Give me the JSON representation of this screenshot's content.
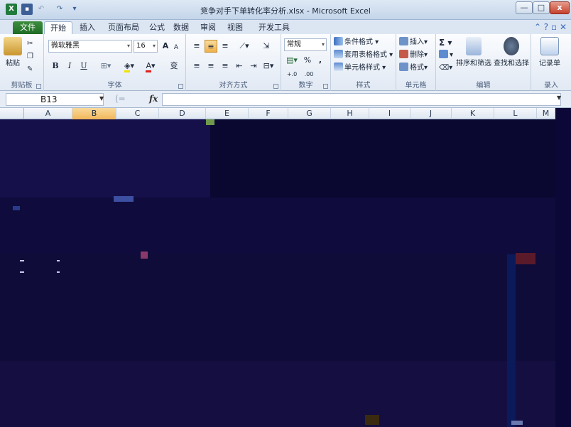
{
  "window": {
    "title": "竞争对手下单转化率分析.xlsx - Microsoft Excel",
    "app_icon_label": "X",
    "min_glyph": "—",
    "max_glyph": "□",
    "close_glyph": "x"
  },
  "tabs": [
    {
      "label": "文件"
    },
    {
      "label": "开始"
    },
    {
      "label": "插入"
    },
    {
      "label": "页面布局"
    },
    {
      "label": "公式"
    },
    {
      "label": "数据"
    },
    {
      "label": "审阅"
    },
    {
      "label": "视图"
    },
    {
      "label": "开发工具"
    }
  ],
  "ribbon": {
    "clipboard": {
      "label": "剪贴板",
      "paste": "粘贴"
    },
    "font": {
      "label": "字体",
      "font_name": "微软雅黑",
      "font_size": "16",
      "bold": "B",
      "italic": "I",
      "underline": "U",
      "grow": "A",
      "shrink": "A",
      "wen": "变"
    },
    "alignment": {
      "label": "对齐方式"
    },
    "number": {
      "label": "数字",
      "format": "常规",
      "percent": "%",
      "comma": ","
    },
    "styles": {
      "label": "样式",
      "conditional": "条件格式",
      "table": "套用表格格式",
      "cell": "单元格样式"
    },
    "cells": {
      "label": "单元格",
      "insert": "插入",
      "delete": "删除",
      "format": "格式"
    },
    "editing": {
      "label": "编辑",
      "sum": "Σ",
      "sort": "排序和筛选",
      "find": "查找和选择"
    },
    "records": {
      "label": "录入",
      "form": "记录单"
    }
  },
  "formula_bar": {
    "name_box": "B13",
    "fx": "fx",
    "value": ""
  },
  "columns": [
    "A",
    "B",
    "C",
    "D",
    "E",
    "F",
    "G",
    "H",
    "I",
    "J",
    "K",
    "L",
    "M"
  ],
  "selected_column": "B"
}
